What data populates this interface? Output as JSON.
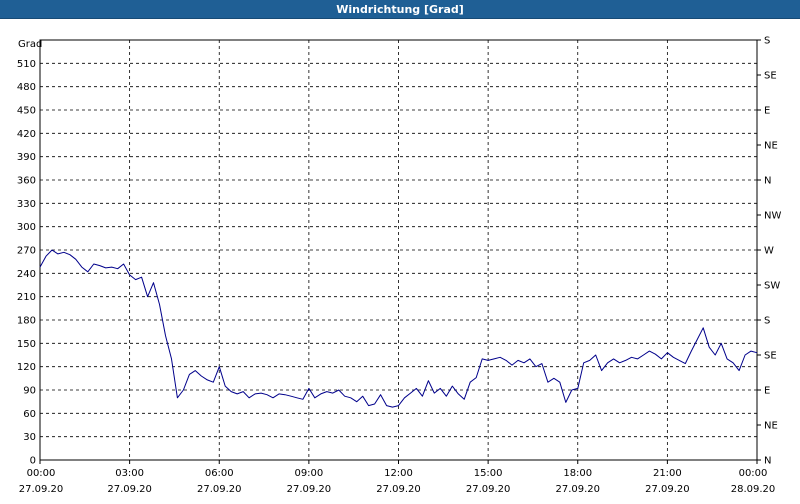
{
  "window": {
    "title": "Windrichtung [Grad]"
  },
  "chart_data": {
    "type": "line",
    "title": "Windrichtung [Grad]",
    "ylabel": "Grad",
    "xlabel": "",
    "ylim": [
      0,
      540
    ],
    "yticks": [
      0,
      30,
      60,
      90,
      120,
      150,
      180,
      210,
      240,
      270,
      300,
      330,
      360,
      390,
      420,
      450,
      480,
      510
    ],
    "y2ticks": [
      {
        "value": 0,
        "label": "N"
      },
      {
        "value": 45,
        "label": "NE"
      },
      {
        "value": 90,
        "label": "E"
      },
      {
        "value": 135,
        "label": "SE"
      },
      {
        "value": 180,
        "label": "S"
      },
      {
        "value": 225,
        "label": "SW"
      },
      {
        "value": 270,
        "label": "W"
      },
      {
        "value": 315,
        "label": "NW"
      },
      {
        "value": 360,
        "label": "N"
      },
      {
        "value": 405,
        "label": "NE"
      },
      {
        "value": 450,
        "label": "E"
      },
      {
        "value": 495,
        "label": "SE"
      },
      {
        "value": 540,
        "label": "S"
      }
    ],
    "xlim": [
      0,
      24
    ],
    "xticks": [
      {
        "value": 0,
        "time": "00:00",
        "date": "27.09.20"
      },
      {
        "value": 3,
        "time": "03:00",
        "date": "27.09.20"
      },
      {
        "value": 6,
        "time": "06:00",
        "date": "27.09.20"
      },
      {
        "value": 9,
        "time": "09:00",
        "date": "27.09.20"
      },
      {
        "value": 12,
        "time": "12:00",
        "date": "27.09.20"
      },
      {
        "value": 15,
        "time": "15:00",
        "date": "27.09.20"
      },
      {
        "value": 18,
        "time": "18:00",
        "date": "27.09.20"
      },
      {
        "value": 21,
        "time": "21:00",
        "date": "27.09.20"
      },
      {
        "value": 24,
        "time": "00:00",
        "date": "28.09.20"
      }
    ],
    "grid": true,
    "series": [
      {
        "color": "#00008b",
        "x": [
          0.0,
          0.2,
          0.4,
          0.6,
          0.8,
          1.0,
          1.2,
          1.4,
          1.6,
          1.8,
          2.0,
          2.2,
          2.4,
          2.6,
          2.8,
          3.0,
          3.2,
          3.4,
          3.6,
          3.8,
          4.0,
          4.2,
          4.4,
          4.6,
          4.8,
          5.0,
          5.2,
          5.4,
          5.6,
          5.8,
          6.0,
          6.2,
          6.4,
          6.6,
          6.8,
          7.0,
          7.2,
          7.4,
          7.6,
          7.8,
          8.0,
          8.2,
          8.4,
          8.6,
          8.8,
          9.0,
          9.2,
          9.4,
          9.6,
          9.8,
          10.0,
          10.2,
          10.4,
          10.6,
          10.8,
          11.0,
          11.2,
          11.4,
          11.6,
          11.8,
          12.0,
          12.2,
          12.4,
          12.6,
          12.8,
          13.0,
          13.2,
          13.4,
          13.6,
          13.8,
          14.0,
          14.2,
          14.4,
          14.6,
          14.8,
          15.0,
          15.2,
          15.4,
          15.6,
          15.8,
          16.0,
          16.2,
          16.4,
          16.6,
          16.8,
          17.0,
          17.2,
          17.4,
          17.6,
          17.8,
          18.0,
          18.2,
          18.4,
          18.6,
          18.8,
          19.0,
          19.2,
          19.4,
          19.6,
          19.8,
          20.0,
          20.2,
          20.4,
          20.6,
          20.8,
          21.0,
          21.2,
          21.4,
          21.6,
          21.8,
          22.0,
          22.2,
          22.4,
          22.6,
          22.8,
          23.0,
          23.2,
          23.4,
          23.6,
          23.8,
          24.0
        ],
        "values": [
          248,
          262,
          270,
          265,
          267,
          264,
          258,
          248,
          242,
          252,
          250,
          247,
          248,
          246,
          252,
          238,
          232,
          235,
          210,
          228,
          200,
          160,
          130,
          80,
          90,
          110,
          115,
          108,
          103,
          100,
          120,
          95,
          88,
          85,
          88,
          80,
          85,
          86,
          84,
          80,
          85,
          84,
          82,
          80,
          78,
          92,
          80,
          85,
          88,
          86,
          90,
          82,
          80,
          75,
          82,
          70,
          72,
          84,
          70,
          68,
          70,
          80,
          86,
          92,
          82,
          102,
          86,
          92,
          82,
          95,
          85,
          78,
          100,
          106,
          130,
          128,
          130,
          132,
          128,
          122,
          128,
          125,
          130,
          120,
          124,
          100,
          105,
          100,
          74,
          90,
          92,
          125,
          128,
          135,
          115,
          125,
          130,
          125,
          128,
          132,
          130,
          135,
          140,
          136,
          130,
          138,
          132,
          128,
          124,
          140,
          155,
          170,
          145,
          135,
          150,
          130,
          125,
          115,
          135,
          140,
          138
        ]
      }
    ]
  }
}
